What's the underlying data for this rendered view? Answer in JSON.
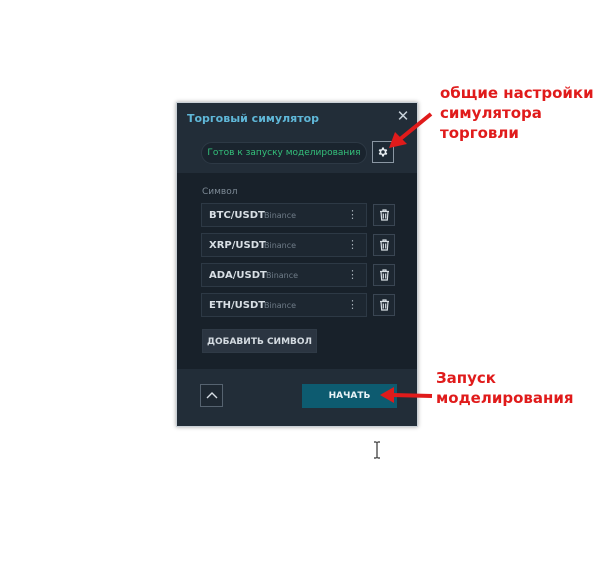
{
  "panel": {
    "title": "Торговый симулятор",
    "status": "Готов к запуску моделирования",
    "symbol_label": "Символ",
    "symbols": [
      {
        "pair": "BTC/USDT",
        "exchange": "Binance"
      },
      {
        "pair": "XRP/USDT",
        "exchange": "Binance"
      },
      {
        "pair": "ADA/USDT",
        "exchange": "Binance"
      },
      {
        "pair": "ETH/USDT",
        "exchange": "Binance"
      }
    ],
    "add_symbol": "ДОБАВИТЬ СИМВОЛ",
    "start": "НАЧАТЬ"
  },
  "annotations": {
    "settings_note": [
      "общие настройки",
      "симулятора",
      "торговли"
    ],
    "start_note": [
      "Запуск",
      "моделирования"
    ]
  },
  "colors": {
    "accent": "#5fb7d8",
    "status_green": "#34c07b",
    "start_button": "#0d5b70",
    "annotation_red": "#e01b1b"
  },
  "icons": [
    "close-icon",
    "gear-icon",
    "more-vertical-icon",
    "trash-icon",
    "chevron-up-icon",
    "text-cursor-icon",
    "arrow-icon"
  ]
}
